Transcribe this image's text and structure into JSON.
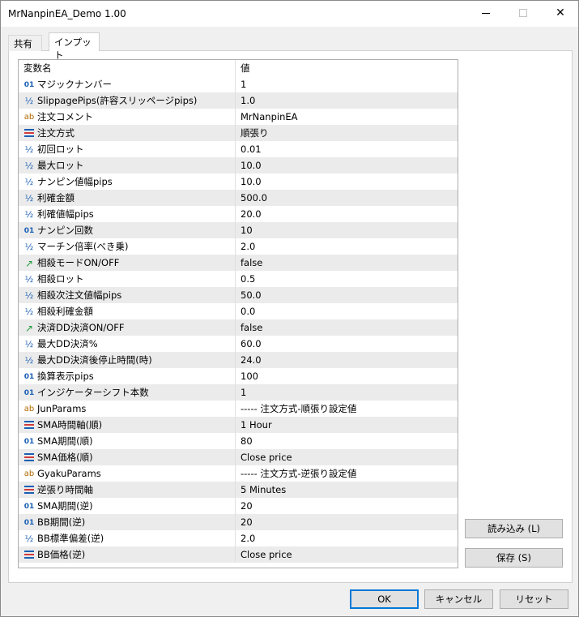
{
  "window": {
    "title": "MrNanpinEA_Demo 1.00",
    "minimize_label": "minimize",
    "maximize_label": "maximize",
    "close_label": "close"
  },
  "tabs": [
    {
      "label": "共有"
    },
    {
      "label": "インプット"
    }
  ],
  "grid": {
    "header": {
      "name": "変数名",
      "value": "値"
    },
    "rows": [
      {
        "icon": "int",
        "name": "マジックナンバー",
        "value": "1"
      },
      {
        "icon": "dbl",
        "name": "SlippagePips(許容スリッページpips)",
        "value": "1.0"
      },
      {
        "icon": "str",
        "name": "注文コメント",
        "value": "MrNanpinEA"
      },
      {
        "icon": "enum",
        "name": "注文方式",
        "value": "順張り"
      },
      {
        "icon": "dbl",
        "name": "初回ロット",
        "value": "0.01"
      },
      {
        "icon": "dbl",
        "name": "最大ロット",
        "value": "10.0"
      },
      {
        "icon": "dbl",
        "name": "ナンピン値幅pips",
        "value": "10.0"
      },
      {
        "icon": "dbl",
        "name": "利確金額",
        "value": "500.0"
      },
      {
        "icon": "dbl",
        "name": "利確値幅pips",
        "value": "20.0"
      },
      {
        "icon": "int",
        "name": "ナンピン回数",
        "value": "10"
      },
      {
        "icon": "dbl",
        "name": "マーチン倍率(べき乗)",
        "value": "2.0"
      },
      {
        "icon": "bool",
        "name": "相殺モードON/OFF",
        "value": "false"
      },
      {
        "icon": "dbl",
        "name": "相殺ロット",
        "value": "0.5"
      },
      {
        "icon": "dbl",
        "name": "相殺次注文値幅pips",
        "value": "50.0"
      },
      {
        "icon": "dbl",
        "name": "相殺利確金額",
        "value": "0.0"
      },
      {
        "icon": "bool",
        "name": "決済DD決済ON/OFF",
        "value": "false"
      },
      {
        "icon": "dbl",
        "name": "最大DD決済%",
        "value": "60.0"
      },
      {
        "icon": "dbl",
        "name": "最大DD決済後停止時間(時)",
        "value": "24.0"
      },
      {
        "icon": "int",
        "name": "換算表示pips",
        "value": "100"
      },
      {
        "icon": "int",
        "name": "インジケーターシフト本数",
        "value": "1"
      },
      {
        "icon": "str",
        "name": "JunParams",
        "value": "----- 注文方式-順張り設定値"
      },
      {
        "icon": "enum",
        "name": "SMA時間軸(順)",
        "value": "1 Hour"
      },
      {
        "icon": "int",
        "name": "SMA期間(順)",
        "value": "80"
      },
      {
        "icon": "enum",
        "name": "SMA価格(順)",
        "value": "Close price"
      },
      {
        "icon": "str",
        "name": "GyakuParams",
        "value": "----- 注文方式-逆張り設定値"
      },
      {
        "icon": "enum",
        "name": "逆張り時間軸",
        "value": "5 Minutes"
      },
      {
        "icon": "int",
        "name": "SMA期間(逆)",
        "value": "20"
      },
      {
        "icon": "int",
        "name": "BB期間(逆)",
        "value": "20"
      },
      {
        "icon": "dbl",
        "name": "BB標準偏差(逆)",
        "value": "2.0"
      },
      {
        "icon": "enum",
        "name": "BB価格(逆)",
        "value": "Close price"
      }
    ]
  },
  "icons": {
    "int": "01",
    "dbl": "½",
    "str": "ab",
    "bool": "↗"
  },
  "colors": {
    "accent": "#0078d7",
    "icon_blue": "#1a5fb4",
    "icon_string": "#b06a00",
    "icon_bool": "#1f9b3a",
    "enum_red": "#d23b3b"
  },
  "buttons": {
    "load": "読み込み (L)",
    "save": "保存 (S)",
    "ok": "OK",
    "cancel": "キャンセル",
    "reset": "リセット"
  }
}
